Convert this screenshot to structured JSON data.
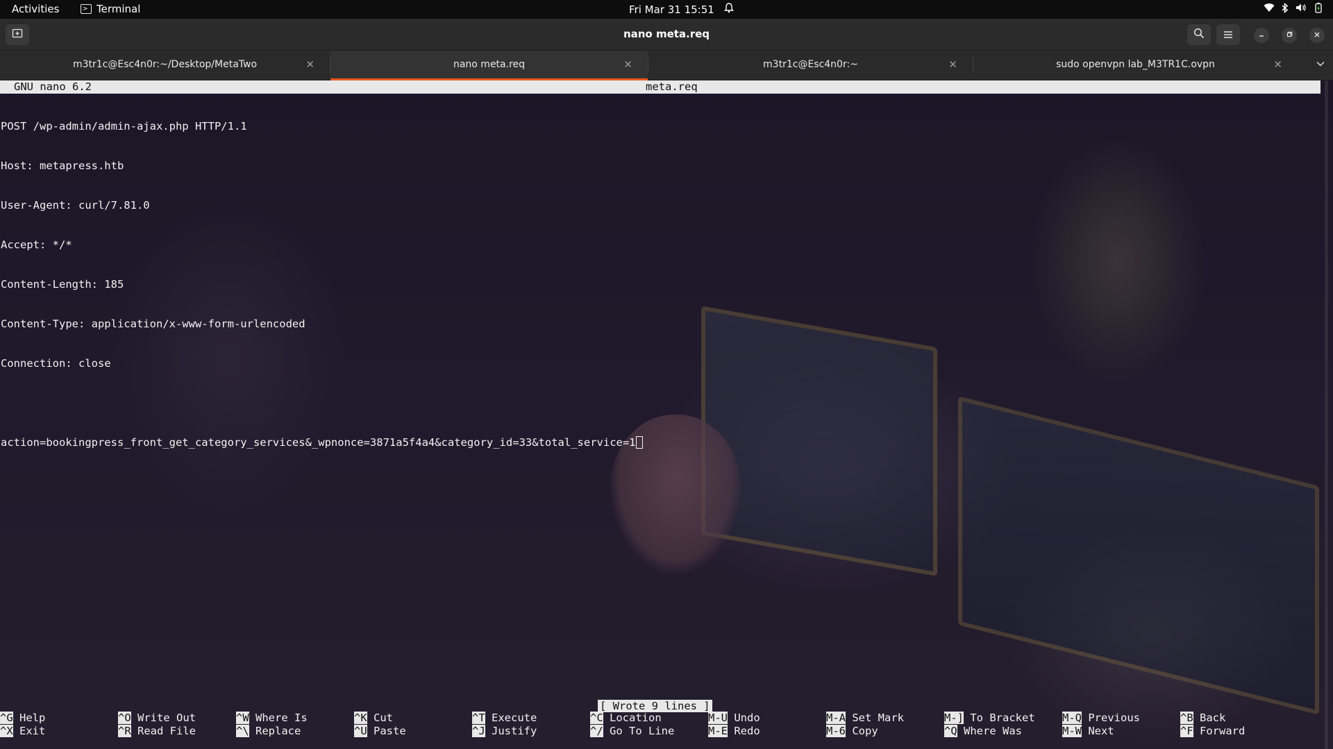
{
  "topbar": {
    "activities": "Activities",
    "app_name": "Terminal",
    "clock_date": "Fri Mar 31",
    "clock_time": "15:51"
  },
  "window": {
    "title": "nano meta.req"
  },
  "tabs": [
    {
      "label": "m3tr1c@Esc4n0r:~/Desktop/MetaTwo",
      "active": false
    },
    {
      "label": "nano meta.req",
      "active": true
    },
    {
      "label": "m3tr1c@Esc4n0r:~",
      "active": false
    },
    {
      "label": "sudo openvpn lab_M3TR1C.ovpn",
      "active": false
    }
  ],
  "nano": {
    "version": "GNU nano 6.2",
    "filename": "meta.req",
    "lines": [
      "POST /wp-admin/admin-ajax.php HTTP/1.1",
      "Host: metapress.htb",
      "User-Agent: curl/7.81.0",
      "Accept: */*",
      "Content-Length: 185",
      "Content-Type: application/x-www-form-urlencoded",
      "Connection: close",
      "",
      "action=bookingpress_front_get_category_services&_wpnonce=3871a5f4a4&category_id=33&total_service=1"
    ],
    "status": "[ Wrote 9 lines ]",
    "shortcuts": [
      {
        "k1": "^G",
        "l1": "Help",
        "k2": "^X",
        "l2": "Exit"
      },
      {
        "k1": "^O",
        "l1": "Write Out",
        "k2": "^R",
        "l2": "Read File"
      },
      {
        "k1": "^W",
        "l1": "Where Is",
        "k2": "^\\",
        "l2": "Replace"
      },
      {
        "k1": "^K",
        "l1": "Cut",
        "k2": "^U",
        "l2": "Paste"
      },
      {
        "k1": "^T",
        "l1": "Execute",
        "k2": "^J",
        "l2": "Justify"
      },
      {
        "k1": "^C",
        "l1": "Location",
        "k2": "^/",
        "l2": "Go To Line"
      },
      {
        "k1": "M-U",
        "l1": "Undo",
        "k2": "M-E",
        "l2": "Redo"
      },
      {
        "k1": "M-A",
        "l1": "Set Mark",
        "k2": "M-6",
        "l2": "Copy"
      },
      {
        "k1": "M-]",
        "l1": "To Bracket",
        "k2": "^Q",
        "l2": "Where Was"
      },
      {
        "k1": "M-Q",
        "l1": "Previous",
        "k2": "M-W",
        "l2": "Next"
      },
      {
        "k1": "^B",
        "l1": "Back",
        "k2": "^F",
        "l2": "Forward"
      }
    ]
  },
  "icons": {
    "new_tab": "new-tab-icon",
    "search": "search-icon",
    "menu": "hamburger-menu-icon",
    "minimize": "minimize-icon",
    "maximize": "maximize-icon",
    "close": "close-icon"
  },
  "colors": {
    "accent": "#e95420",
    "topbar": "#0d0d0d",
    "headerbar": "#2b2b2b",
    "nano_bar": "#e8e8e8"
  }
}
